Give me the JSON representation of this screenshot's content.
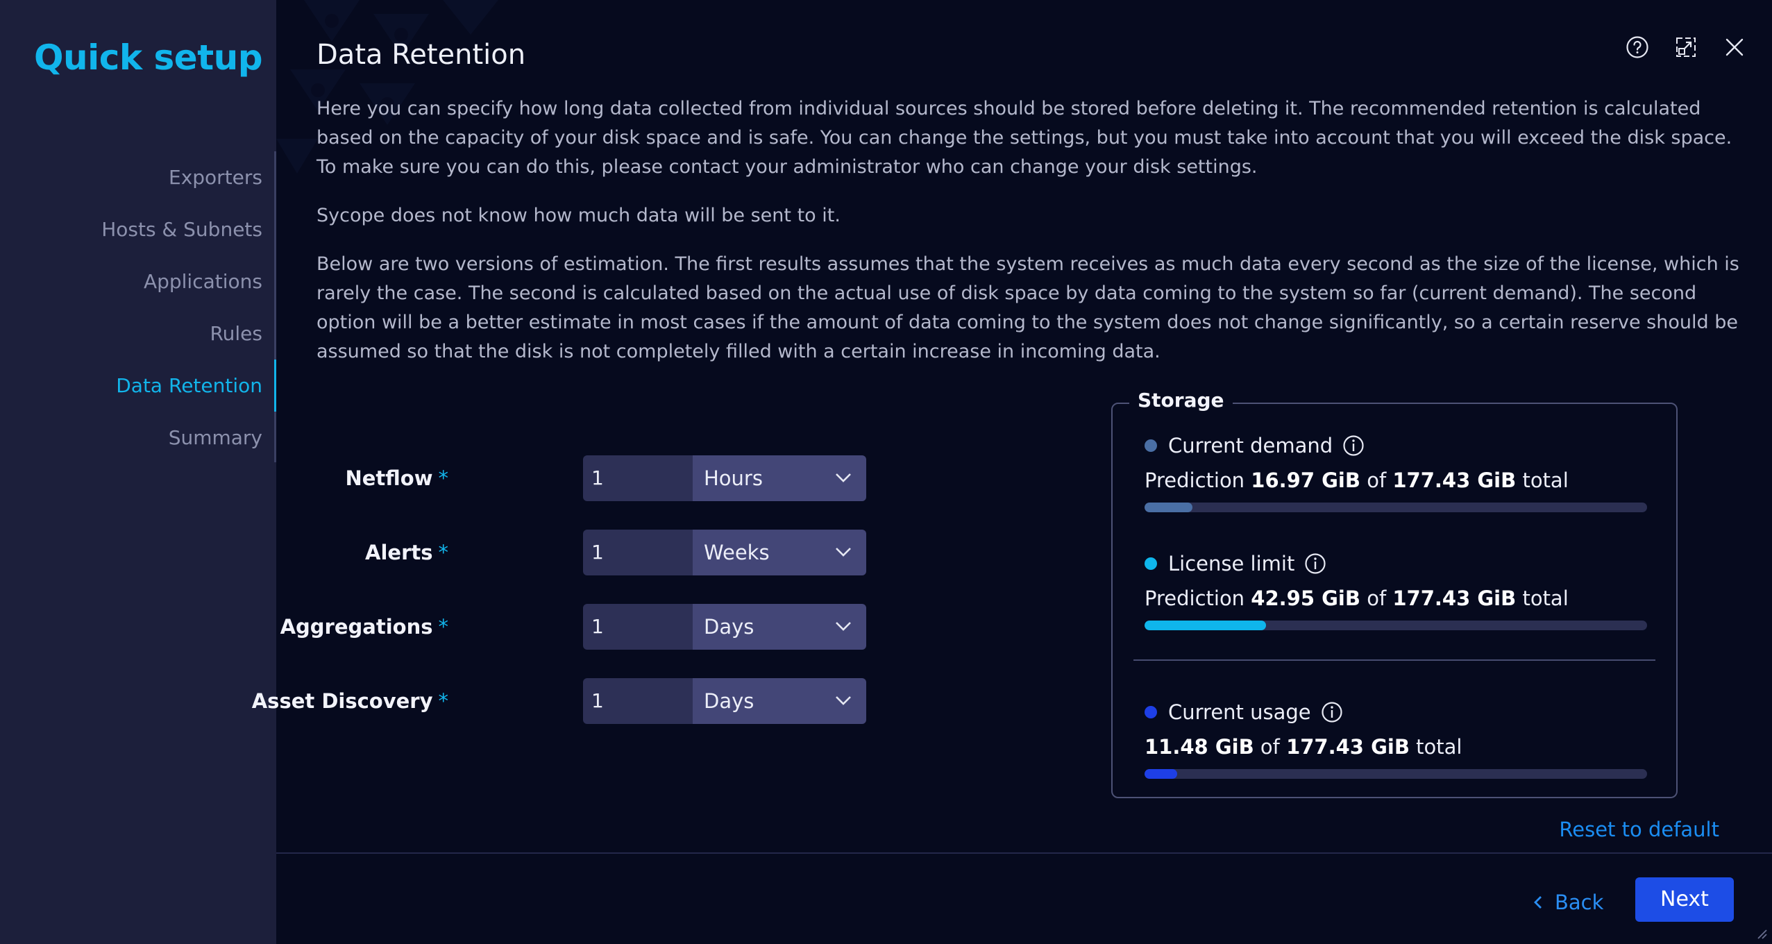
{
  "sidebar": {
    "title": "Quick setup",
    "steps": [
      {
        "label": "Exporters"
      },
      {
        "label": "Hosts & Subnets"
      },
      {
        "label": "Applications"
      },
      {
        "label": "Rules"
      },
      {
        "label": "Data Retention"
      },
      {
        "label": "Summary"
      }
    ],
    "active_step": "Data Retention"
  },
  "header": {
    "title": "Data Retention",
    "icons": [
      "help-icon",
      "popout-icon",
      "close-icon"
    ]
  },
  "description": {
    "p1": "Here you can specify how long data collected from individual sources should be stored before deleting it. The recommended retention is calculated based on the capacity of your disk space and is safe. You can change the settings, but you must take into account that you will exceed the disk space. To make sure you can do this, please contact your administrator who can change your disk settings.",
    "p2": "Sycope does not know how much data will be sent to it.",
    "p3": "Below are two versions of estimation. The first results assumes that the system receives as much data every second as the size of the license, which is rarely the case. The second is calculated based on the actual use of disk space by data coming to the system so far (current demand). The second option will be a better estimate in most cases if the amount of data coming to the system does not change significantly, so a certain reserve should be assumed so that the disk is not completely filled with a certain increase in incoming data."
  },
  "form": {
    "required_mark": "*",
    "rows": [
      {
        "label": "Netflow",
        "value": "1",
        "unit": "Hours"
      },
      {
        "label": "Alerts",
        "value": "1",
        "unit": "Weeks"
      },
      {
        "label": "Aggregations",
        "value": "1",
        "unit": "Days"
      },
      {
        "label": "Asset Discovery",
        "value": "1",
        "unit": "Days"
      }
    ]
  },
  "storage": {
    "legend": "Storage",
    "of_word": "of",
    "total_word": "total",
    "prediction_word": "Prediction",
    "metrics": [
      {
        "name": "Current demand",
        "value": "16.97 GiB",
        "capacity": "177.43 GiB",
        "fraction": 0.0956,
        "color": "#4a6fa5",
        "has_prediction": true
      },
      {
        "name": "License limit",
        "value": "42.95 GiB",
        "capacity": "177.43 GiB",
        "fraction": 0.242,
        "color": "#0fb6ec",
        "has_prediction": true
      },
      {
        "name": "Current usage",
        "value": "11.48 GiB",
        "capacity": "177.43 GiB",
        "fraction": 0.0647,
        "color": "#1e3fe6",
        "has_prediction": false
      }
    ]
  },
  "actions": {
    "reset": "Reset to default",
    "back": "Back",
    "next": "Next"
  }
}
